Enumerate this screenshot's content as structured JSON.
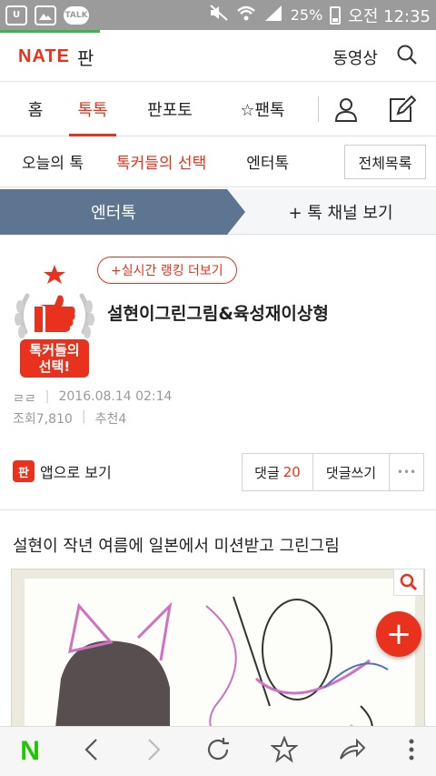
{
  "statusbar": {
    "talk_label": "TALK",
    "battery": "25%",
    "time": "오전 12:35"
  },
  "header": {
    "logo_text": "NATE",
    "logo_sub": "판",
    "video_label": "동영상"
  },
  "tabs": [
    {
      "label": "홈"
    },
    {
      "label": "톡톡",
      "active": true
    },
    {
      "label": "판포토"
    },
    {
      "label": "☆팬톡"
    }
  ],
  "subtabs": [
    {
      "label": "오늘의 톡"
    },
    {
      "label": "톡커들의 선택",
      "active": true
    },
    {
      "label": "엔터톡"
    }
  ],
  "all_list_label": "전체목록",
  "channel": {
    "active": "엔터톡",
    "other": "+ 톡 채널 보기"
  },
  "article": {
    "badge_line1": "톡커들의",
    "badge_line2": "선택!",
    "rank_button": "+실시간 랭킹 더보기",
    "title": "설현이그린그림&육성재이상형",
    "author": "ㄹㄹ",
    "date": "2016.08.14 02:14",
    "views": "조회7,810",
    "likes": "추천4",
    "app_icon_text": "판",
    "app_view": "앱으로 보기",
    "comment_label": "댓글",
    "comment_count": "20",
    "write_comment": "댓글쓰기",
    "more": "•••",
    "subtitle": "설현이 작년 여름에 일본에서 미션받고 그린그림"
  },
  "fab_label": "+",
  "bottombar": {
    "naver_label": "N"
  },
  "colors": {
    "accent": "#e8321e",
    "channel_active": "#5e7592",
    "naver_green": "#1ec800"
  }
}
